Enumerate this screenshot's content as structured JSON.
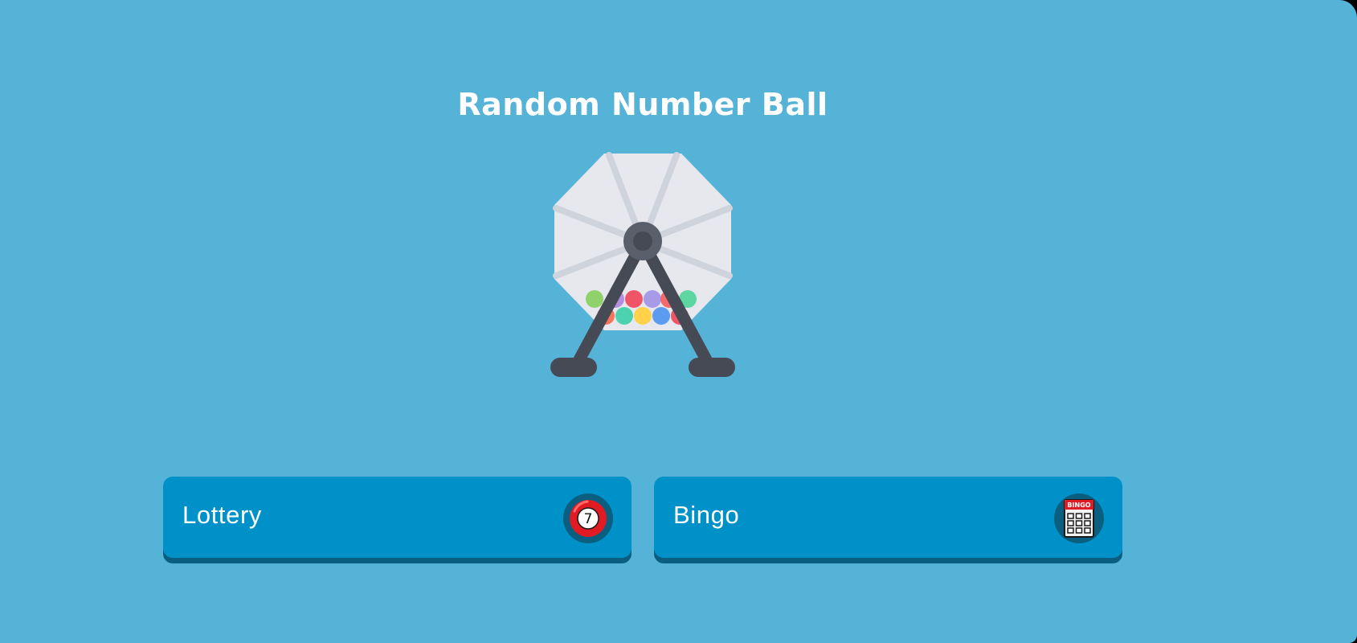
{
  "app": {
    "title": "Random Number Ball",
    "colors": {
      "background": "#55b3d8",
      "button": "#0091c9",
      "button_shadow": "#0a5f80"
    }
  },
  "buttons": [
    {
      "label": "Lottery",
      "icon": "lottery-ball-icon",
      "ball_number": "7"
    },
    {
      "label": "Bingo",
      "icon": "bingo-card-icon",
      "card_header": "BINGO"
    }
  ]
}
